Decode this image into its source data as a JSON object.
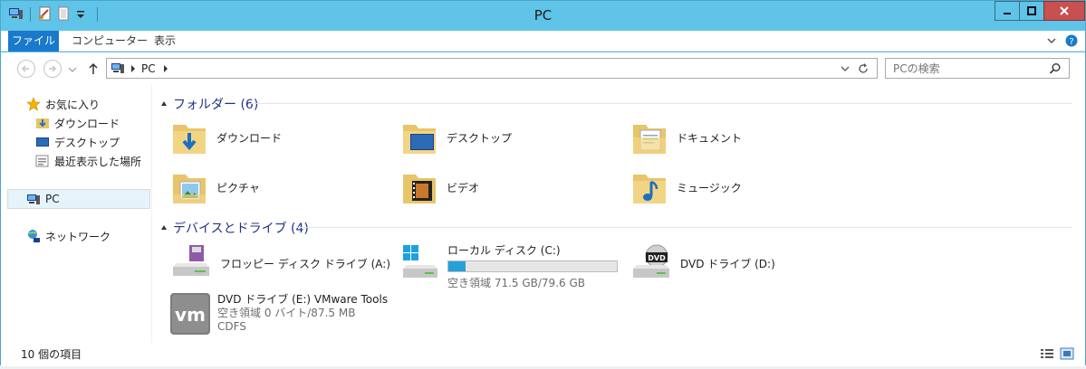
{
  "window": {
    "title": "PC"
  },
  "ribbon": {
    "tabs": [
      "ファイル",
      "コンピューター",
      "表示"
    ]
  },
  "address": {
    "crumb": "PC"
  },
  "search": {
    "placeholder": "PCの検索"
  },
  "sidebar": {
    "favorites": "お気に入り",
    "items": [
      "ダウンロード",
      "デスクトップ",
      "最近表示した場所"
    ],
    "pc": "PC",
    "network": "ネットワーク"
  },
  "folders": {
    "header": "フォルダー (6)",
    "items": [
      "ダウンロード",
      "デスクトップ",
      "ドキュメント",
      "ピクチャ",
      "ビデオ",
      "ミュージック"
    ]
  },
  "devices": {
    "header": "デバイスとドライブ (4)",
    "floppy": "フロッピー ディスク ドライブ (A:)",
    "local": {
      "name": "ローカル ディスク (C:)",
      "free": "空き領域 71.5 GB/79.6 GB",
      "used_fraction": 0.102
    },
    "dvd_d": "DVD ドライブ (D:)",
    "dvd_e": {
      "name": "DVD ドライブ (E:) VMware Tools",
      "free": "空き領域 0 バイト/87.5 MB",
      "fs": "CDFS"
    }
  },
  "status": {
    "count": "10 個の項目"
  },
  "colors": {
    "titlebar": "#5fc4e8",
    "accent": "#1979ca",
    "group_header": "#1e3287",
    "bar_fill": "#26a0da"
  }
}
